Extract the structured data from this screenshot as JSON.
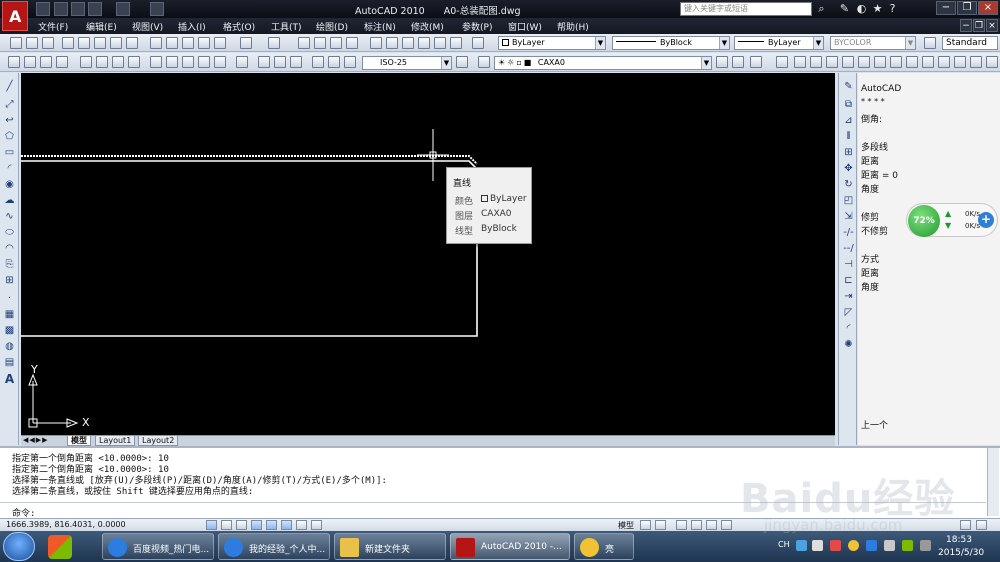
{
  "window": {
    "app_title": "AutoCAD 2010",
    "file_name": "A0-总装配图.dwg",
    "search_placeholder": "键入关键字或短语"
  },
  "menu": [
    "文件(F)",
    "编辑(E)",
    "视图(V)",
    "插入(I)",
    "格式(O)",
    "工具(T)",
    "绘图(D)",
    "标注(N)",
    "修改(M)",
    "参数(P)",
    "窗口(W)",
    "帮助(H)"
  ],
  "properties_toolbar": {
    "color": "ByLayer",
    "linetype": "ByBlock",
    "lineweight": "ByLayer",
    "plotstyle": "BYCOLOR",
    "text_style": "Standard"
  },
  "dim_style": "ISO-25",
  "layer": "CAXA0",
  "tooltip": {
    "title": "直线",
    "rows": [
      {
        "label": "颜色",
        "value": "ByLayer"
      },
      {
        "label": "图层",
        "value": "CAXA0"
      },
      {
        "label": "线型",
        "value": "ByBlock"
      }
    ]
  },
  "ucs": {
    "x": "X",
    "y": "Y"
  },
  "layout_tabs": [
    "模型",
    "Layout1",
    "Layout2"
  ],
  "prompt_panel": {
    "header": "AutoCAD",
    "dots": "* * * *",
    "items": [
      "倒角:",
      "多段线",
      "距离",
      "距离 = 0",
      "角度",
      "修剪",
      "不修剪",
      "方式",
      "距离",
      "角度",
      "上一个"
    ]
  },
  "net_widget": {
    "percent": "72%",
    "up": "0K/s",
    "down": "0K/s"
  },
  "command_lines": [
    "指定第一个倒角距离 <10.0000>: 10",
    "指定第二个倒角距离 <10.0000>: 10",
    "选择第一条直线或 [放弃(U)/多段线(P)/距离(D)/角度(A)/修剪(T)/方式(E)/多个(M)]:",
    "选择第二条直线，或按住 Shift 键选择要应用角点的直线:"
  ],
  "command_prompt": "命令:",
  "status": {
    "coords": "1666.3989, 816.4031, 0.0000",
    "model_label": "模型"
  },
  "taskbar": {
    "apps": [
      "百度视频_热门电...",
      "我的经验_个人中...",
      "新建文件夹",
      "AutoCAD 2010 -...",
      "亮"
    ],
    "ime": "CH",
    "time": "18:53",
    "date": "2015/5/30"
  },
  "watermark": {
    "brand": "Baidu经验",
    "url": "jingyan.baidu.com"
  },
  "colors": {
    "canvas": "#000000",
    "geometry": "#ffffff",
    "accent_red": "#b51515"
  }
}
